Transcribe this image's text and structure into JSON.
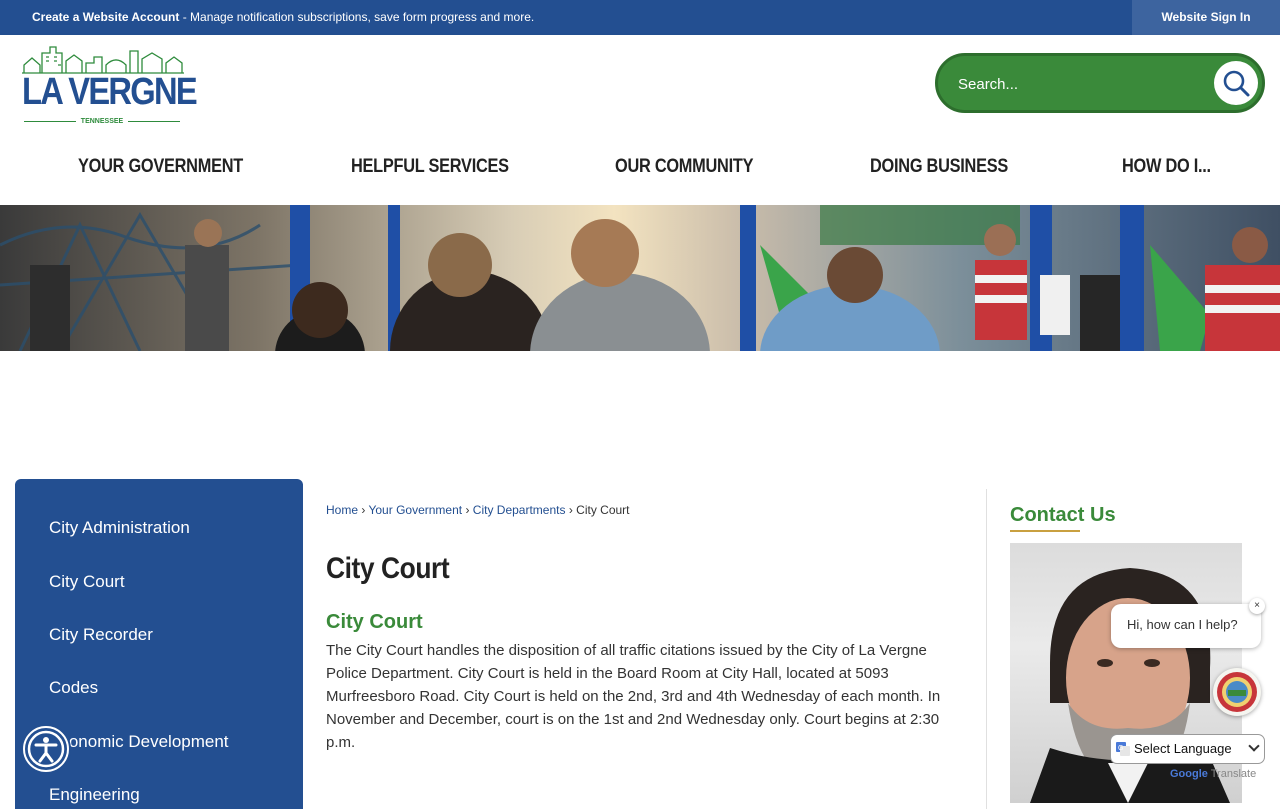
{
  "topbar": {
    "account_label": "Create a Website Account",
    "account_desc": " - Manage notification subscriptions, save form progress and more.",
    "signin_label": "Website Sign In"
  },
  "logo": {
    "word": "LA VERGNE",
    "state": "TENNESSEE"
  },
  "search": {
    "placeholder": "Search..."
  },
  "nav": {
    "items": [
      {
        "label": "YOUR GOVERNMENT"
      },
      {
        "label": "HELPFUL SERVICES"
      },
      {
        "label": "OUR COMMUNITY"
      },
      {
        "label": "DOING BUSINESS"
      },
      {
        "label": "HOW DO I..."
      }
    ]
  },
  "sidebar": {
    "items": [
      {
        "label": "City Administration"
      },
      {
        "label": "City Court"
      },
      {
        "label": "City Recorder"
      },
      {
        "label": "Codes"
      },
      {
        "label": "Economic Development"
      },
      {
        "label": "Engineering"
      }
    ]
  },
  "breadcrumb": {
    "home": "Home",
    "sep": "›",
    "level1": "Your Government",
    "level2": "City Departments",
    "current": "City Court"
  },
  "main": {
    "title": "City Court",
    "subtitle": "City Court",
    "body": "The City Court handles the disposition of all traffic citations issued by the City of La Vergne Police Department. City Court is held in the Board Room at City Hall, located at 5093 Murfreesboro Road. City Court is held on the 2nd, 3rd and 4th Wednesday of each month. In November and December, court is on the 1st and 2nd Wednesday only. Court begins at 2:30 p.m."
  },
  "contact": {
    "title": "Contact Us"
  },
  "chat": {
    "greeting": "Hi, how can I help?",
    "close": "×"
  },
  "translate": {
    "select_label": "Select Language",
    "google": "Google",
    "translate": "Translate"
  },
  "colors": {
    "brand_blue": "#234f91",
    "brand_green": "#3a8a3a",
    "accent_gold": "#c9a040"
  }
}
